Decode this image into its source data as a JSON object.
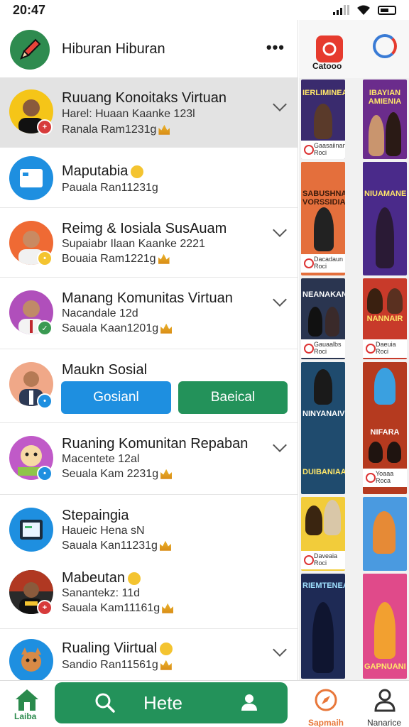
{
  "status": {
    "time": "20:47"
  },
  "header": {
    "title": "Hiburan Hiburan",
    "more": "•••"
  },
  "rows": [
    {
      "title": "Ruuang Konoitaks Virtuan",
      "sub": "Harel: Huaan Kaanke 123l",
      "meta": "Ranala Ram1231g"
    },
    {
      "title": "Maputabia",
      "meta": "Paual­a Ran11231g"
    },
    {
      "title": "Reimg & Iosiala Sus­Auam",
      "sub": "Supaiabr Ilaan Kaanke 2221",
      "meta": "Bouaia Ram1221g"
    },
    {
      "title": "Manang Komunitas Virtuan",
      "sub": "Nacandale 12d",
      "meta": "Sauala Kaan1201g"
    },
    {
      "title": "Maukn Sosial",
      "btn_a": "Gosianl",
      "btn_b": "Baeical"
    },
    {
      "title": "Ruaning Komunitan Repaban",
      "sub": "Macentete 12al",
      "meta": "Seuala Kam 2231g"
    },
    {
      "title": "Stepaingia",
      "sub": "Haueic Hena sN",
      "meta": "Sauala Kan11231g"
    },
    {
      "title": "Mabeutan",
      "sub": "Sanantekz: 11d",
      "meta": "Sauala Kam11161g"
    },
    {
      "title": "Rualing Viirtual",
      "meta": "Sandio Ran11561g"
    }
  ],
  "right_panel": {
    "cat_label": "Catooo",
    "tiles": [
      {
        "title": "IERLIMINEAI",
        "cap": "Gaasaiinan\nRoci"
      },
      {
        "title": "IBAYIAN AMIENIA",
        "cap": ""
      },
      {
        "title": "SABUSHNA VORSSIDIA",
        "cap": "Dacadaun\nRoci"
      },
      {
        "title": "NIUAMANE",
        "cap": ""
      },
      {
        "title": "NEANAKAN",
        "cap": "Gauaalbs\nRoci"
      },
      {
        "title": "NANNAIR",
        "cap": "Daeuia\nRoci"
      },
      {
        "title": "NINYANAIV",
        "cap": ""
      },
      {
        "title": "NIFARA",
        "cap": "Yoaaa\nRoca"
      },
      {
        "title": "DUIBANIAAL",
        "cap": ""
      },
      {
        "title": "",
        "cap": "Daveaia\nRoci"
      },
      {
        "title": "",
        "cap": ""
      },
      {
        "title": "RIEMTENEAI",
        "cap": ""
      },
      {
        "title": "GAPNUANI",
        "cap": ""
      }
    ]
  },
  "bottom_nav": {
    "home": "Laiba",
    "search": "Hete",
    "nav_a": "Sapmaih",
    "nav_b": "Nanarice"
  },
  "colors": {
    "green": "#23925a",
    "blue": "#1e8fe0",
    "red": "#e63b2e"
  }
}
